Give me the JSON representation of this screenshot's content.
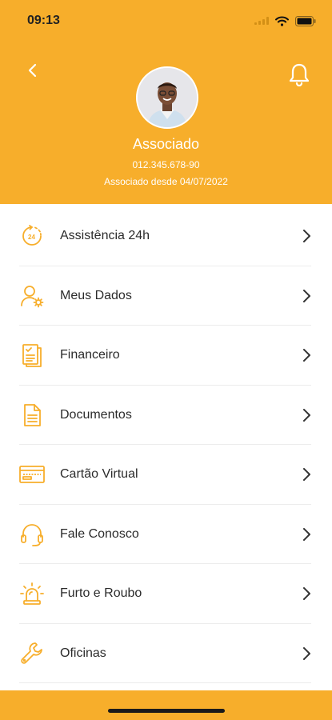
{
  "status_bar": {
    "time": "09:13"
  },
  "profile": {
    "name": "Associado",
    "document": "012.345.678-90",
    "member_since": "Associado desde 04/07/2022"
  },
  "menu": [
    {
      "label": "Assistência 24h",
      "icon": "assistance-24h-icon"
    },
    {
      "label": "Meus Dados",
      "icon": "user-settings-icon"
    },
    {
      "label": "Financeiro",
      "icon": "financial-checklist-icon"
    },
    {
      "label": "Documentos",
      "icon": "document-icon"
    },
    {
      "label": "Cartão Virtual",
      "icon": "card-icon"
    },
    {
      "label": "Fale Conosco",
      "icon": "headset-icon"
    },
    {
      "label": "Furto e Roubo",
      "icon": "siren-icon"
    },
    {
      "label": "Oficinas",
      "icon": "wrench-icon"
    }
  ],
  "colors": {
    "accent": "#F7AE2B",
    "text": "#2b2b2b",
    "divider": "#ececec"
  }
}
